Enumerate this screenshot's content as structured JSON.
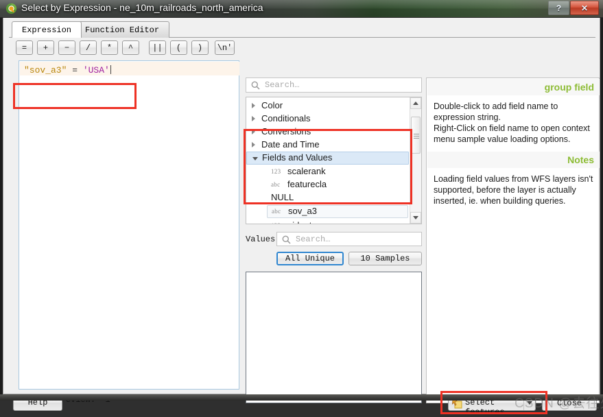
{
  "window": {
    "title": "Select by Expression - ne_10m_railroads_north_america",
    "icon": "qgis-logo-icon",
    "help_button": "?",
    "close_button": "✕"
  },
  "tabs": [
    {
      "label": "Expression",
      "active": true
    },
    {
      "label": "Function Editor",
      "active": false
    }
  ],
  "operators": [
    {
      "label": "=",
      "name": "equals"
    },
    {
      "label": "+",
      "name": "plus"
    },
    {
      "label": "−",
      "name": "minus"
    },
    {
      "label": "/",
      "name": "divide"
    },
    {
      "label": "*",
      "name": "multiply"
    },
    {
      "label": "^",
      "name": "power"
    },
    {
      "label": "||",
      "name": "concat"
    },
    {
      "label": "(",
      "name": "open-paren"
    },
    {
      "label": ")",
      "name": "close-paren"
    },
    {
      "label": "\\n'",
      "name": "newline"
    }
  ],
  "expression": {
    "field_token": "\"sov_a3\"",
    "operator_token": " = ",
    "string_token": "'USA'",
    "full_text": "\"sov_a3\" = 'USA'"
  },
  "output_preview": {
    "label": "Output preview:",
    "value": "1"
  },
  "function_tree": {
    "search_placeholder": "Search…",
    "items": [
      {
        "label": "Color",
        "type": "group",
        "expanded": false,
        "icon": ""
      },
      {
        "label": "Conditionals",
        "type": "group",
        "expanded": false,
        "icon": ""
      },
      {
        "label": "Conversions",
        "type": "group",
        "expanded": false,
        "icon": ""
      },
      {
        "label": "Date and Time",
        "type": "group",
        "expanded": false,
        "icon": ""
      },
      {
        "label": "Fields and Values",
        "type": "group",
        "expanded": true,
        "icon": "",
        "selected": true
      },
      {
        "label": "scalerank",
        "type": "field",
        "icon": "123"
      },
      {
        "label": "featurecla",
        "type": "field",
        "icon": "abc"
      },
      {
        "label": "NULL",
        "type": "value",
        "icon": ""
      },
      {
        "label": "sov_a3",
        "type": "field",
        "icon": "abc",
        "highlighted": true
      },
      {
        "label": "uident",
        "type": "field",
        "icon": "123"
      }
    ]
  },
  "values": {
    "label": "Values",
    "search_placeholder": "Search…",
    "all_unique_button": "All Unique",
    "samples_button": "10 Samples",
    "list_items": []
  },
  "help": {
    "group_heading": "group field",
    "group_text": "Double-click to add field name to expression string.\nRight-Click on field name to open context menu sample value loading options.",
    "notes_heading": "Notes",
    "notes_text": "Loading field values from WFS layers isn't supported, before the layer is actually inserted, ie. when building queries.",
    "heading_color": "#8dbc35"
  },
  "footer": {
    "help_button": "Help",
    "select_features_button": "Select features",
    "select_features_icon": "select-features-icon",
    "close_button": "Close"
  },
  "watermark": {
    "text": "CSDN @去往火星"
  },
  "annotations": {
    "accent_color": "#ee3124",
    "regions": [
      "expression-field",
      "fields-and-values-tree",
      "bottom-action-buttons"
    ]
  }
}
